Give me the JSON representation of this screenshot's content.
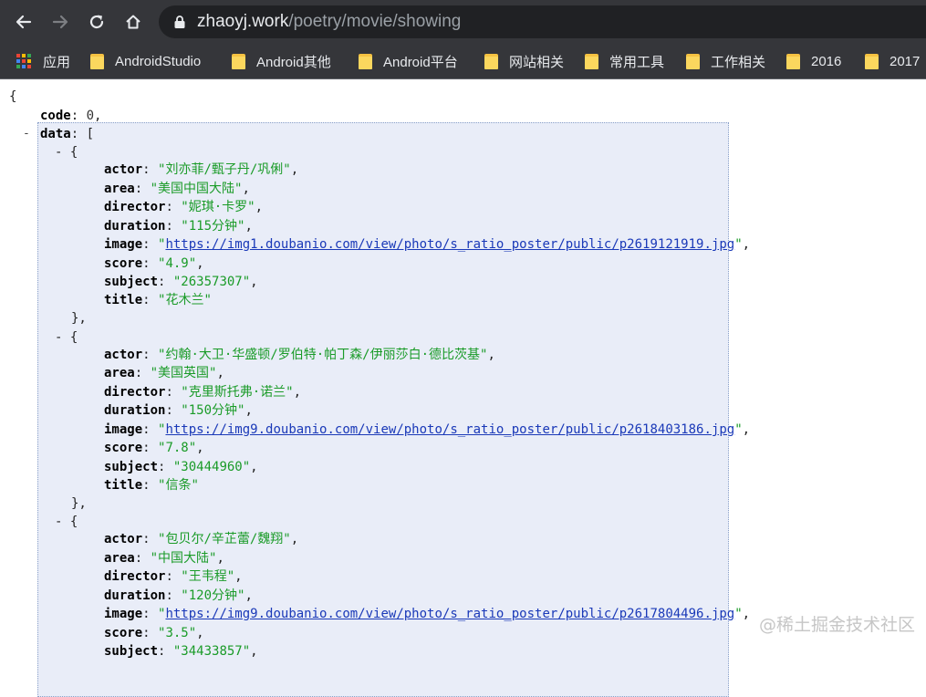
{
  "browser": {
    "url_host": "zhaoyj.work",
    "url_path": "/poetry/movie/showing",
    "bookmarks": [
      {
        "label": "应用",
        "icon": "apps-grid-icon"
      },
      {
        "label": "AndroidStudio",
        "icon": "folder-icon"
      },
      {
        "label": "Android其他",
        "icon": "folder-icon"
      },
      {
        "label": "Android平台",
        "icon": "folder-icon"
      },
      {
        "label": "网站相关",
        "icon": "folder-icon"
      },
      {
        "label": "常用工具",
        "icon": "folder-icon"
      },
      {
        "label": "工作相关",
        "icon": "folder-icon"
      },
      {
        "label": "2016",
        "icon": "folder-icon"
      },
      {
        "label": "2017",
        "icon": "folder-icon"
      }
    ]
  },
  "json": {
    "open_brace": "{",
    "code_key": "code",
    "code_value": "0",
    "data_key": "data",
    "collapse_symbol": "-",
    "items": [
      {
        "actor": "\"刘亦菲/甄子丹/巩俐\"",
        "area": "\"美国中国大陆\"",
        "director": "\"妮琪·卡罗\"",
        "duration": "\"115分钟\"",
        "image": "https://img1.doubanio.com/view/photo/s_ratio_poster/public/p2619121919.jpg",
        "score": "\"4.9\"",
        "subject": "\"26357307\"",
        "title": "\"花木兰\""
      },
      {
        "actor": "\"约翰·大卫·华盛顿/罗伯特·帕丁森/伊丽莎白·德比茨基\"",
        "area": "\"美国英国\"",
        "director": "\"克里斯托弗·诺兰\"",
        "duration": "\"150分钟\"",
        "image": "https://img9.doubanio.com/view/photo/s_ratio_poster/public/p2618403186.jpg",
        "score": "\"7.8\"",
        "subject": "\"30444960\"",
        "title": "\"信条\""
      },
      {
        "actor": "\"包贝尔/辛芷蕾/魏翔\"",
        "area": "\"中国大陆\"",
        "director": "\"王韦程\"",
        "duration": "\"120分钟\"",
        "image": "https://img9.doubanio.com/view/photo/s_ratio_poster/public/p2617804496.jpg",
        "score": "\"3.5\"",
        "subject": "\"34433857\""
      }
    ]
  },
  "watermark": "@稀土掘金技术社区",
  "colors": {
    "string": "#1a9b28",
    "link": "#1a39b8",
    "highlight_bg": "#e9edf8",
    "chrome_bg": "#35363a",
    "omnibox_bg": "#202124"
  }
}
